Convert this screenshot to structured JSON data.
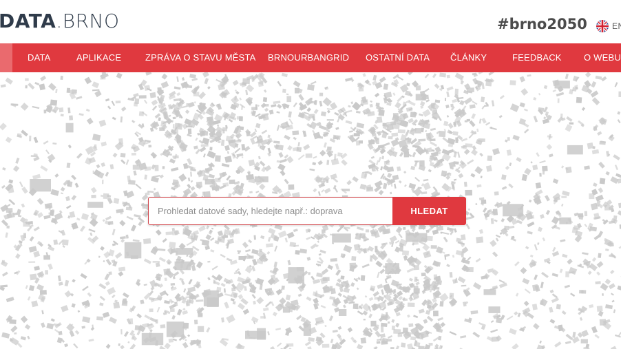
{
  "header": {
    "logo_strong": "DATA",
    "logo_light": ".BRNO",
    "hashtag": "#brno2050",
    "language": {
      "icon": "uk-flag-icon",
      "label": "EN"
    }
  },
  "nav": {
    "items": [
      {
        "label": "DATA"
      },
      {
        "label": "APLIKACE"
      },
      {
        "label": "ZPRÁVA O STAVU MĚSTA"
      },
      {
        "label": "BRNOURBANGRID"
      },
      {
        "label": "OSTATNÍ DATA"
      },
      {
        "label": "ČLÁNKY"
      },
      {
        "label": "FEEDBACK"
      },
      {
        "label": "O WEBU"
      }
    ]
  },
  "search": {
    "placeholder": "Prohledat datové sady, hledejte např.: doprava",
    "value": "",
    "button_label": "HLEDAT"
  },
  "colors": {
    "accent": "#e0393f",
    "map_buildings": "#c9c9c9"
  }
}
